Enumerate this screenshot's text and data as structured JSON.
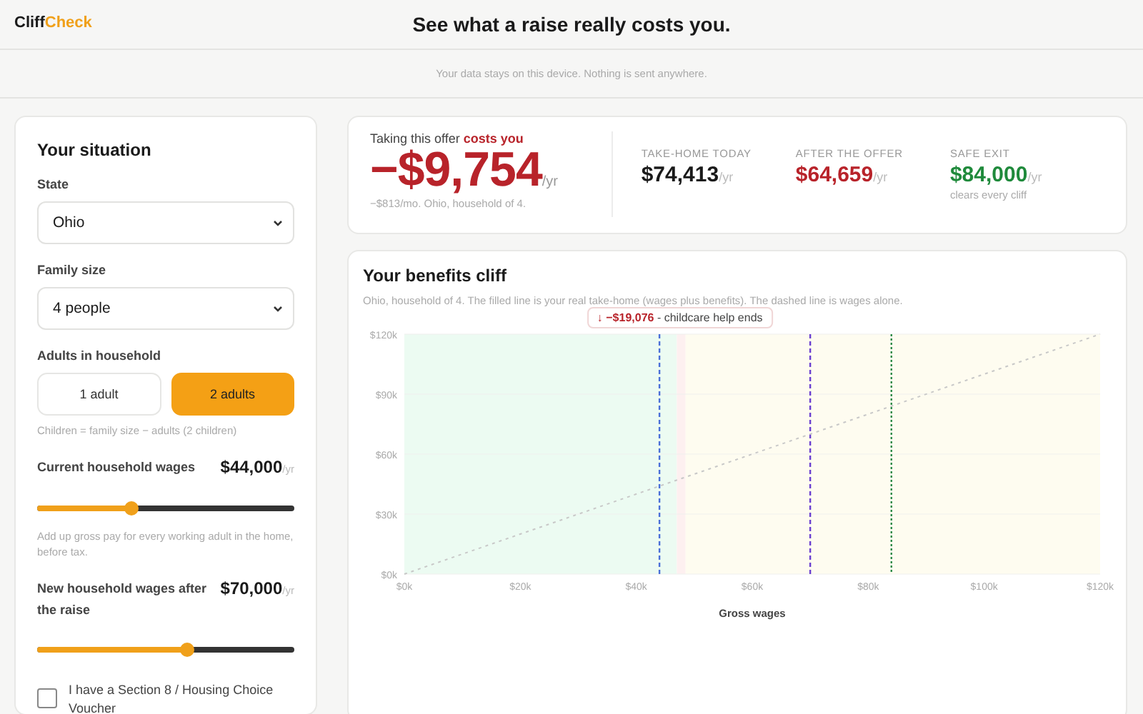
{
  "brand": {
    "part_1": "Cliff",
    "part_2": "Check"
  },
  "headline": "See what a raise really costs you.",
  "notice": "Your data stays on this device. Nothing is sent anywhere.",
  "situation": {
    "title": "Your situation",
    "state": {
      "label": "State",
      "value": "Ohio"
    },
    "family_size": {
      "label": "Family size",
      "value": "4 people"
    },
    "adults": {
      "label": "Adults in household",
      "options": [
        {
          "label": "1 adult",
          "selected": false
        },
        {
          "label": "2 adults",
          "selected": true
        }
      ],
      "hint": "Children = family size − adults (2 children)"
    },
    "wages": [
      {
        "label": "Current household wages",
        "value": "$44,000",
        "unit": "/yr",
        "level": 0.367,
        "hint": "Add up gross pay for every working adult in the home, before tax."
      },
      {
        "label": "New household wages after the raise",
        "value": "$70,000",
        "unit": "/yr",
        "level": 0.583
      }
    ],
    "voucher": {
      "label": "I have a Section 8 / Housing Choice Voucher",
      "checked": false
    }
  },
  "summary": {
    "lead": "Taking this offer **costs you**",
    "amount": "−$9,754",
    "unit": "/yr",
    "note": "−$813/mo. Ohio, household of 4.",
    "stats": [
      {
        "label": "TAKE-HOME TODAY",
        "value": "$74,413",
        "unit": "/yr",
        "color": "#1a1a1a"
      },
      {
        "label": "AFTER THE OFFER",
        "value": "$64,659",
        "unit": "/yr",
        "color": "#b8232a"
      },
      {
        "label": "SAFE EXIT",
        "value": "$84,000",
        "unit": "/yr",
        "color": "#1f8a3b",
        "note": "clears every cliff"
      }
    ]
  },
  "cliff": {
    "title": "Your benefits cliff",
    "subtitle": "Ohio, household of 4. The filled line is your real take-home (wages plus benefits). The dashed line is wages alone.",
    "chart_data": {
      "type": "line",
      "xlabel": "Gross wages",
      "x": [
        0,
        120000
      ],
      "grid": true,
      "series": [
        {
          "color": "#c8c8c8",
          "line_style": "dashed",
          "values": [
            0,
            120000
          ]
        }
      ],
      "ref_lines": [
        {
          "axis": "x",
          "value": 44000,
          "color": "#4a6fd8"
        },
        {
          "axis": "x",
          "value": 70000,
          "color": "#6a3fd0"
        },
        {
          "axis": "x",
          "value": 84000,
          "color": "#2e8b4a"
        }
      ],
      "bands": [
        {
          "axis": "x",
          "from": 0,
          "to": 47000,
          "color": "#ecfbf2"
        },
        {
          "axis": "x",
          "from": 47000,
          "to": 48500,
          "color": "#fdf0f0"
        },
        {
          "axis": "x",
          "from": 48500,
          "to": 120000,
          "color": "#fefcf0"
        }
      ],
      "annotations": [
        "**↓ −$19,076** - childcare help ends"
      ],
      "xlim": [
        0,
        120000
      ],
      "ylim": [
        0,
        120000
      ],
      "xticks": [
        {
          "value": 0,
          "label": "$0k"
        },
        {
          "value": 20000,
          "label": "$20k"
        },
        {
          "value": 40000,
          "label": "$40k"
        },
        {
          "value": 60000,
          "label": "$60k"
        },
        {
          "value": 80000,
          "label": "$80k"
        },
        {
          "value": 100000,
          "label": "$100k"
        },
        {
          "value": 120000,
          "label": "$120k"
        }
      ],
      "yticks": [
        {
          "value": 0,
          "label": "$0k"
        },
        {
          "value": 30000,
          "label": "$30k"
        },
        {
          "value": 60000,
          "label": "$60k"
        },
        {
          "value": 90000,
          "label": "$90k"
        },
        {
          "value": 120000,
          "label": "$120k"
        }
      ]
    }
  }
}
